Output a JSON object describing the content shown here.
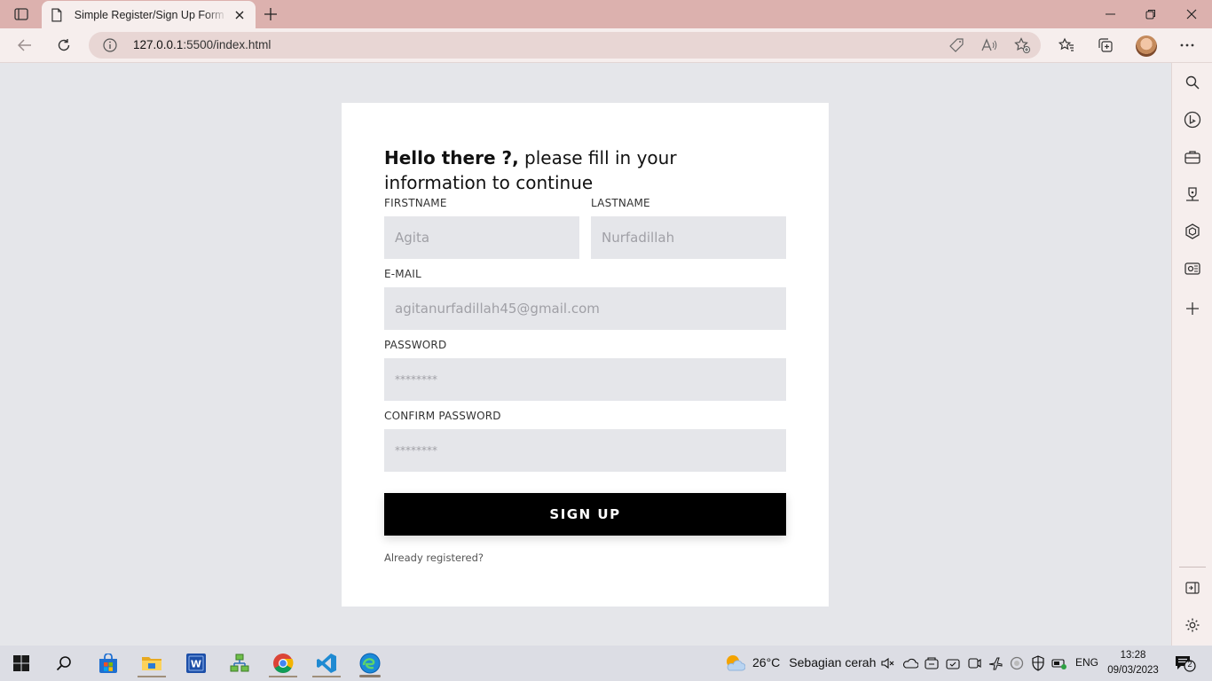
{
  "browser": {
    "tab_title": "Simple Register/Sign Up Form by",
    "url_host": "127.0.0.1",
    "url_rest": ":5500/index.html"
  },
  "form": {
    "heading_bold": "Hello there ?,",
    "heading_rest": " please fill in your information to continue",
    "firstname_label": "FIRSTNAME",
    "firstname_placeholder": "Agita",
    "lastname_label": "LASTNAME",
    "lastname_placeholder": "Nurfadillah",
    "email_label": "E-MAIL",
    "email_placeholder": "agitanurfadillah45@gmail.com",
    "password_label": "PASSWORD",
    "password_placeholder": "********",
    "confirm_label": "CONFIRM PASSWORD",
    "confirm_placeholder": "********",
    "submit_label": "SIGN UP",
    "registered_link": "Already registered?"
  },
  "taskbar": {
    "weather_temp": "26°C",
    "weather_desc": "Sebagian cerah",
    "language": "ENG",
    "time": "13:28",
    "date": "09/03/2023",
    "notification_count": "2"
  },
  "colors": {
    "titlebar": "#dcb1ae",
    "toolbar": "#f6eeed",
    "page_bg": "#e5e6ea",
    "button": "#000000"
  }
}
